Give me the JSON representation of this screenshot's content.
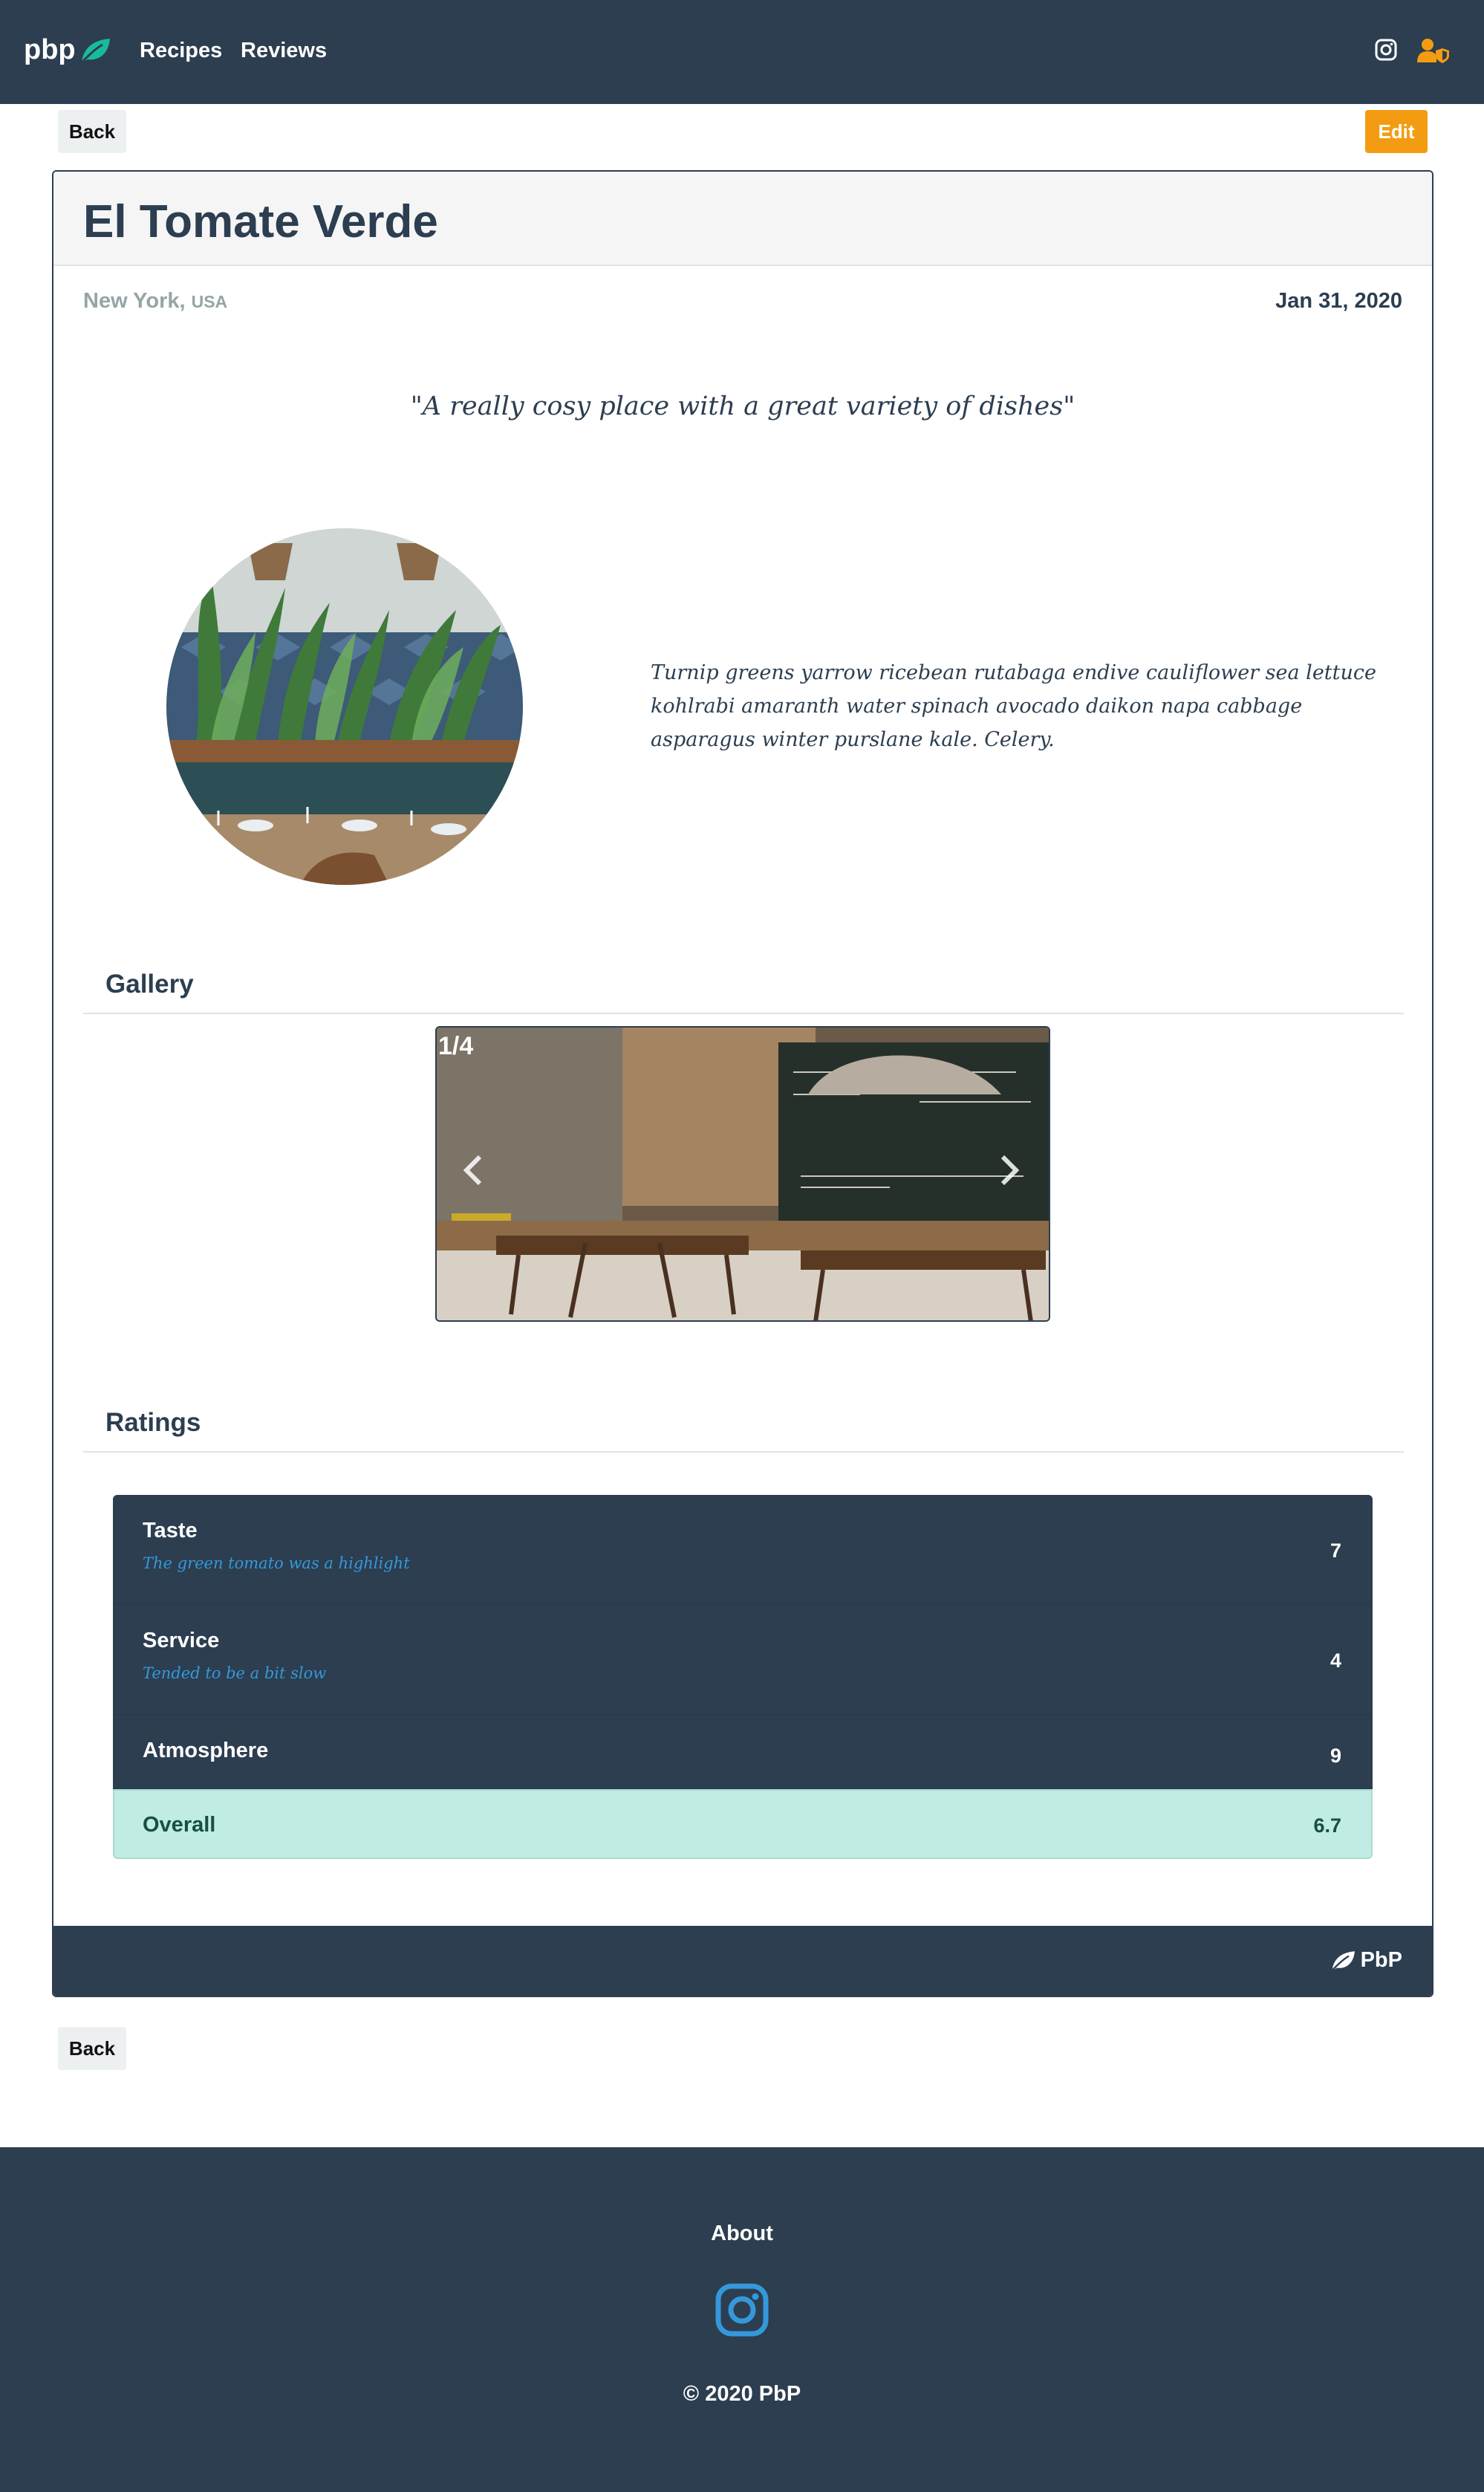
{
  "navbar": {
    "brand": "pbp",
    "links": [
      "Recipes",
      "Reviews"
    ],
    "icons": [
      "instagram-icon",
      "user-shield-icon"
    ]
  },
  "actions": {
    "back_label": "Back",
    "edit_label": "Edit"
  },
  "review": {
    "title": "El Tomate Verde",
    "city": "New York,",
    "country": "USA",
    "date": "Jan 31, 2020",
    "quote": "\"A really cosy place with a great variety of dishes\"",
    "description": "Turnip greens yarrow ricebean rutabaga endive cauliflower sea lettuce kohlrabi amaranth water spinach avocado daikon napa cabbage asparagus winter purslane kale. Celery."
  },
  "gallery": {
    "heading": "Gallery",
    "counter": "1/4"
  },
  "ratings": {
    "heading": "Ratings",
    "items": [
      {
        "label": "Taste",
        "comment": "The green tomato was a highlight",
        "score": "7"
      },
      {
        "label": "Service",
        "comment": "Tended to be a bit slow",
        "score": "4"
      },
      {
        "label": "Atmosphere",
        "comment": "",
        "score": "9"
      }
    ],
    "overall": {
      "label": "Overall",
      "score": "6.7"
    }
  },
  "card_footer": {
    "brand": "PbP"
  },
  "footer": {
    "about": "About",
    "copyright": "© 2020 PbP"
  },
  "colors": {
    "navy": "#2c3e50",
    "teal_accent": "#18bc9c",
    "orange": "#f39c12",
    "blue": "#3498db",
    "overall_bg": "#c1ece3"
  }
}
